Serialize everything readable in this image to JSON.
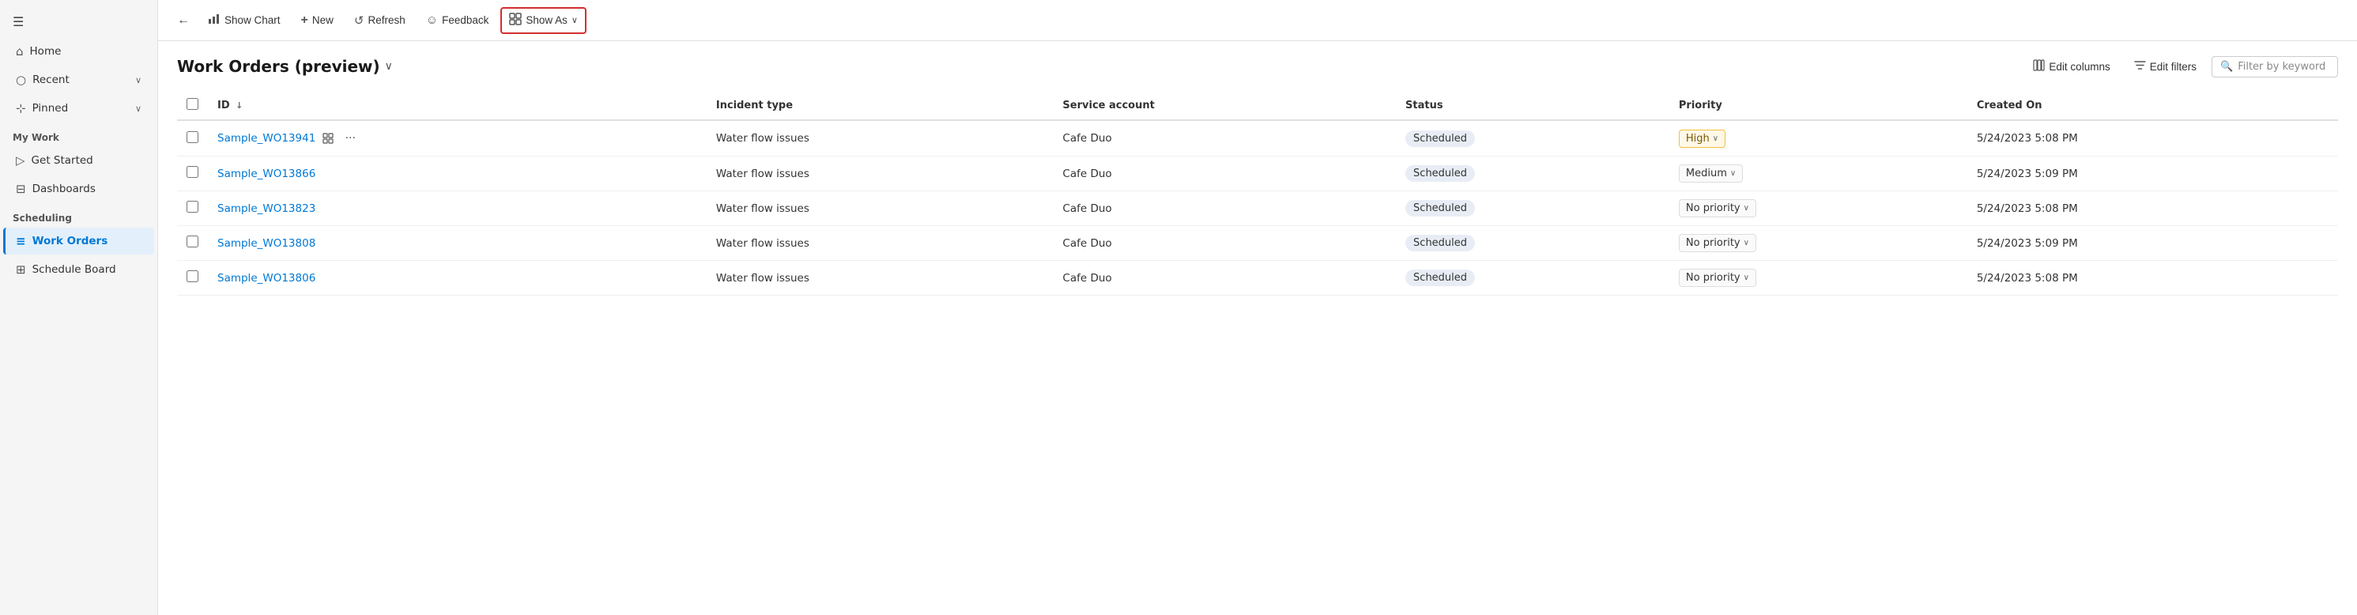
{
  "sidebar": {
    "hamburger_icon": "☰",
    "nav_items": [
      {
        "id": "home",
        "label": "Home",
        "icon": "⌂",
        "has_chevron": false
      },
      {
        "id": "recent",
        "label": "Recent",
        "icon": "○",
        "has_chevron": true
      },
      {
        "id": "pinned",
        "label": "Pinned",
        "icon": "⊹",
        "has_chevron": true
      }
    ],
    "my_work_section": "My Work",
    "my_work_items": [
      {
        "id": "get-started",
        "label": "Get Started",
        "icon": "▷"
      },
      {
        "id": "dashboards",
        "label": "Dashboards",
        "icon": "⊟"
      }
    ],
    "scheduling_section": "Scheduling",
    "scheduling_items": [
      {
        "id": "work-orders",
        "label": "Work Orders",
        "icon": "≡",
        "active": true
      },
      {
        "id": "schedule-board",
        "label": "Schedule Board",
        "icon": "⊞"
      }
    ]
  },
  "toolbar": {
    "back_icon": "←",
    "show_chart_label": "Show Chart",
    "show_chart_icon": "⊟",
    "new_label": "New",
    "new_icon": "+",
    "refresh_label": "Refresh",
    "refresh_icon": "↺",
    "feedback_label": "Feedback",
    "feedback_icon": "☺",
    "show_as_label": "Show As",
    "show_as_icon": "⊞",
    "show_as_chevron": "∨"
  },
  "page": {
    "title": "Work Orders (preview)",
    "title_chevron": "∨",
    "edit_columns_label": "Edit columns",
    "edit_columns_icon": "⊞",
    "edit_filters_label": "Edit filters",
    "edit_filters_icon": "▽",
    "filter_placeholder": "Filter by keyword",
    "filter_icon": "🔍"
  },
  "table": {
    "columns": [
      {
        "id": "id",
        "label": "ID",
        "sort_icon": "↓"
      },
      {
        "id": "incident_type",
        "label": "Incident type"
      },
      {
        "id": "service_account",
        "label": "Service account"
      },
      {
        "id": "status",
        "label": "Status"
      },
      {
        "id": "priority",
        "label": "Priority"
      },
      {
        "id": "created_on",
        "label": "Created On"
      }
    ],
    "rows": [
      {
        "id": "Sample_WO13941",
        "incident_type": "Water flow issues",
        "service_account": "Cafe Duo",
        "status": "Scheduled",
        "priority": "High",
        "priority_class": "high",
        "created_on": "5/24/2023 5:08 PM",
        "has_actions": true
      },
      {
        "id": "Sample_WO13866",
        "incident_type": "Water flow issues",
        "service_account": "Cafe Duo",
        "status": "Scheduled",
        "priority": "Medium",
        "priority_class": "medium",
        "created_on": "5/24/2023 5:09 PM",
        "has_actions": false
      },
      {
        "id": "Sample_WO13823",
        "incident_type": "Water flow issues",
        "service_account": "Cafe Duo",
        "status": "Scheduled",
        "priority": "No priority",
        "priority_class": "none",
        "created_on": "5/24/2023 5:08 PM",
        "has_actions": false
      },
      {
        "id": "Sample_WO13808",
        "incident_type": "Water flow issues",
        "service_account": "Cafe Duo",
        "status": "Scheduled",
        "priority": "No priority",
        "priority_class": "none",
        "created_on": "5/24/2023 5:09 PM",
        "has_actions": false
      },
      {
        "id": "Sample_WO13806",
        "incident_type": "Water flow issues",
        "service_account": "Cafe Duo",
        "status": "Scheduled",
        "priority": "No priority",
        "priority_class": "none",
        "created_on": "5/24/2023 5:08 PM",
        "has_actions": false
      }
    ]
  }
}
